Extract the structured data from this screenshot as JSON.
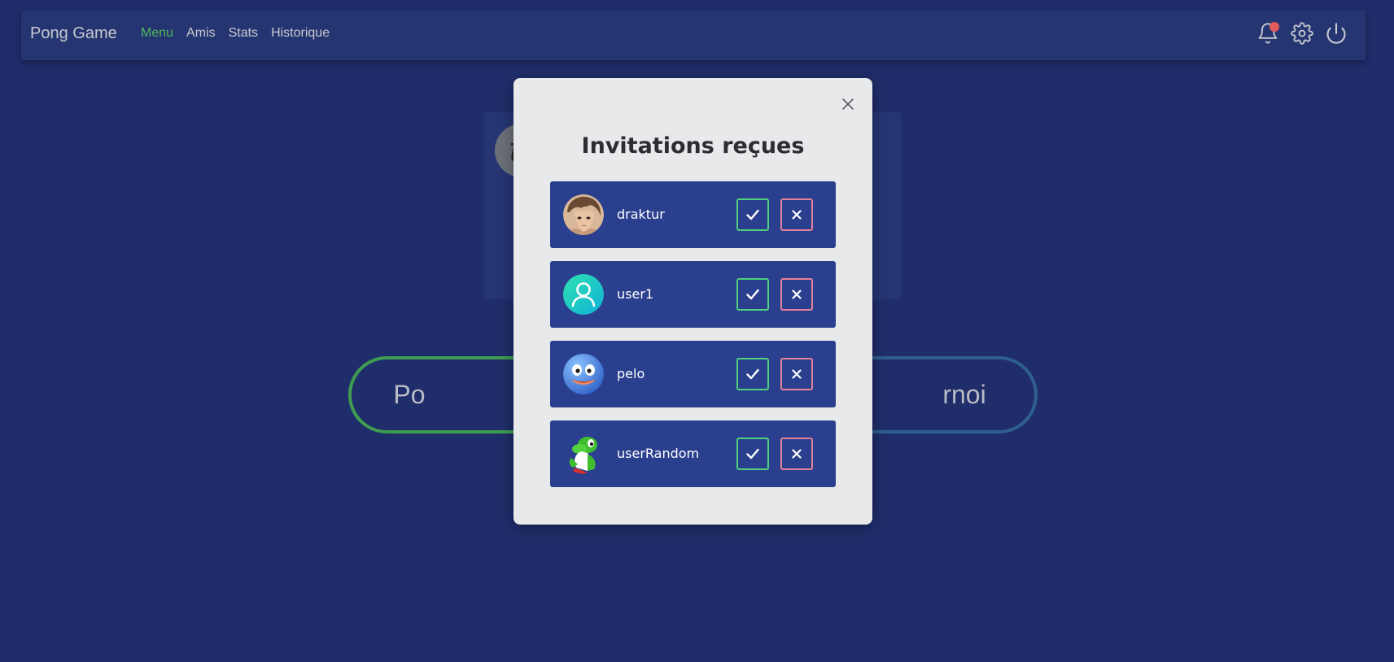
{
  "navbar": {
    "brand": "Pong Game",
    "links": [
      {
        "label": "Menu",
        "active": true
      },
      {
        "label": "Amis",
        "active": false
      },
      {
        "label": "Stats",
        "active": false
      },
      {
        "label": "Historique",
        "active": false
      }
    ],
    "icons": [
      "bell-icon",
      "gear-icon",
      "power-icon"
    ],
    "has_notification": true
  },
  "background": {
    "left_button_label": "Po",
    "right_button_label": "rnoi"
  },
  "modal": {
    "title": "Invitations reçues",
    "invitations": [
      {
        "username": "draktur",
        "avatar": "anime-character-avatar"
      },
      {
        "username": "user1",
        "avatar": "default-user-avatar"
      },
      {
        "username": "pelo",
        "avatar": "blue-slime-avatar"
      },
      {
        "username": "userRandom",
        "avatar": "green-dinosaur-avatar"
      }
    ]
  },
  "colors": {
    "page_bg": "#1f2d6a",
    "navbar_bg": "#253572",
    "active_link": "#4fb85a",
    "notification_dot": "#e15c5c",
    "modal_bg": "#e8e9eb",
    "invite_row_bg": "#2b3f8f",
    "accept_border": "#4fd17d",
    "decline_border": "#e4829a"
  }
}
